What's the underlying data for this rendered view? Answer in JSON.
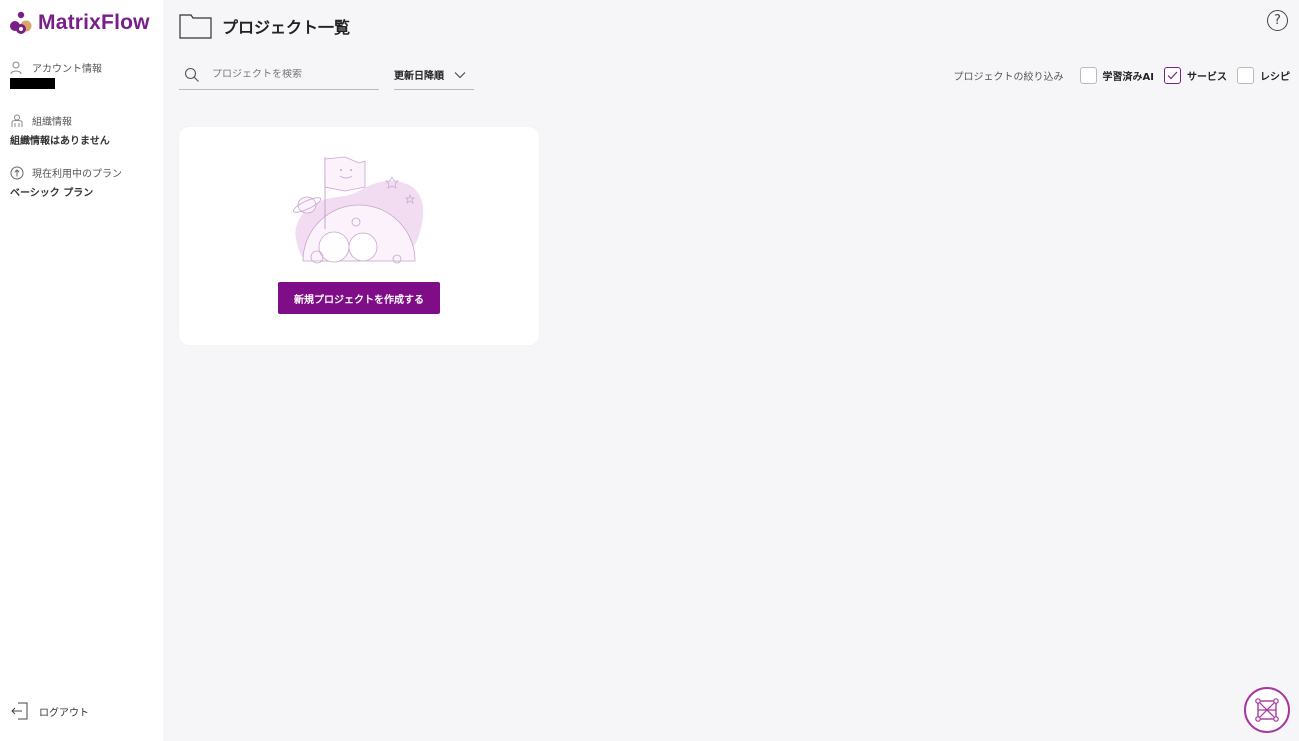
{
  "app": {
    "name": "MatrixFlow",
    "brand_color": "#7a1f8a",
    "accent_color": "#7f0d87"
  },
  "sidebar": {
    "account": {
      "label": "アカウント情報",
      "icon": "user-icon"
    },
    "organization": {
      "label": "組織情報",
      "value": "組織情報はありません",
      "icon": "group-icon"
    },
    "plan": {
      "label": "現在利用中のプラン",
      "value": "ベーシック プラン",
      "icon": "arrow-up-circle-icon"
    },
    "logout": {
      "label": "ログアウト",
      "icon": "logout-icon"
    }
  },
  "header": {
    "title": "プロジェクト一覧",
    "title_icon": "folder-icon",
    "help_label": "?"
  },
  "toolbar": {
    "search_placeholder": "プロジェクトを検索",
    "sort_label": "更新日降順",
    "filter_label": "プロジェクトの絞り込み",
    "filters": [
      {
        "label": "学習済みAI",
        "checked": false
      },
      {
        "label": "サービス",
        "checked": true
      },
      {
        "label": "レシピ",
        "checked": false
      }
    ]
  },
  "card": {
    "create_button_label": "新規プロジェクトを作成する",
    "illustration": "flag-planet-illustration"
  },
  "fab": {
    "icon": "network-icon"
  }
}
